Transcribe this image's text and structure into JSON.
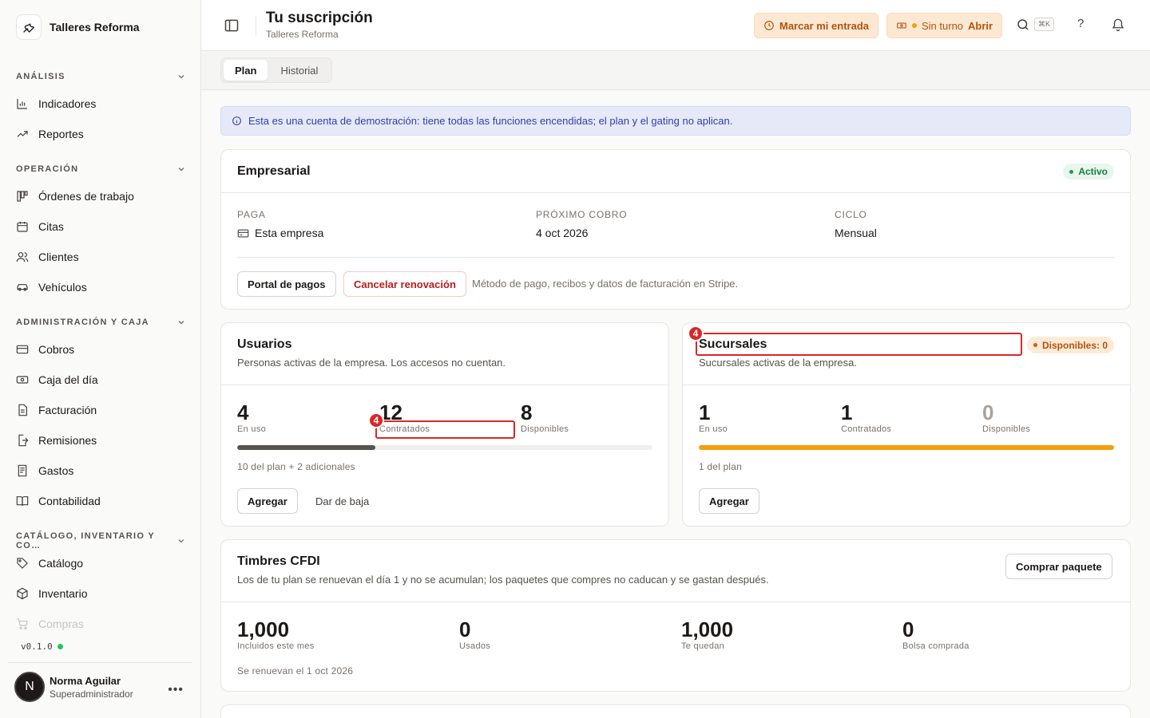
{
  "sidebar": {
    "brand": "Talleres Reforma",
    "sections": [
      {
        "title": "ANÁLISIS"
      },
      {
        "title": "OPERACIÓN"
      },
      {
        "title": "ADMINISTRACIÓN Y CAJA"
      },
      {
        "title": "CATÁLOGO, INVENTARIO Y CO…"
      }
    ],
    "items": [
      {
        "label": "Indicadores",
        "icon": "bar-chart-icon"
      },
      {
        "label": "Reportes",
        "icon": "trending-up-icon"
      },
      {
        "label": "Órdenes de trabajo",
        "icon": "kanban-icon"
      },
      {
        "label": "Citas",
        "icon": "calendar-icon"
      },
      {
        "label": "Clientes",
        "icon": "users-icon"
      },
      {
        "label": "Vehículos",
        "icon": "car-icon"
      },
      {
        "label": "Cobros",
        "icon": "credit-card-icon"
      },
      {
        "label": "Caja del día",
        "icon": "cash-icon"
      },
      {
        "label": "Facturación",
        "icon": "file-text-icon"
      },
      {
        "label": "Remisiones",
        "icon": "file-export-icon"
      },
      {
        "label": "Gastos",
        "icon": "receipt-icon"
      },
      {
        "label": "Contabilidad",
        "icon": "book-open-icon"
      },
      {
        "label": "Catálogo",
        "icon": "tags-icon"
      },
      {
        "label": "Inventario",
        "icon": "package-icon"
      },
      {
        "label": "Compras",
        "icon": "shopping-cart-icon"
      }
    ],
    "version": "v0.1.0",
    "user": {
      "initial": "N",
      "name": "Norma Aguilar",
      "role": "Superadministrador"
    }
  },
  "header": {
    "title": "Tu suscripción",
    "subtitle": "Talleres Reforma",
    "checkin_label": "Marcar mi entrada",
    "shift_status": "Sin turno",
    "shift_action": "Abrir",
    "shortcut": "⌘K",
    "help": "?"
  },
  "tabs": [
    {
      "label": "Plan"
    },
    {
      "label": "Historial"
    }
  ],
  "banner": "Esta es una cuenta de demostración: tiene todas las funciones encendidas; el plan y el gating no aplican.",
  "plan": {
    "name": "Empresarial",
    "status": "Activo",
    "pays_label": "PAGA",
    "pays_value": "Esta empresa",
    "next_label": "PRÓXIMO COBRO",
    "next_value": "4 oct 2026",
    "cycle_label": "CICLO",
    "cycle_value": "Mensual",
    "portal_button": "Portal de pagos",
    "cancel_button": "Cancelar renovación",
    "hint": "Método de pago, recibos y datos de facturación en Stripe."
  },
  "users": {
    "title": "Usuarios",
    "desc": "Personas activas de la empresa. Los accesos no cuentan.",
    "in_use": "4",
    "in_use_label": "En uso",
    "contracted": "12",
    "contracted_label": "Contratados",
    "available": "8",
    "available_label": "Disponibles",
    "usage_fraction": 0.333,
    "note": "10 del plan + 2 adicionales",
    "add_button": "Agregar",
    "remove_button": "Dar de baja",
    "marker": "4"
  },
  "branches": {
    "title": "Sucursales",
    "desc": "Sucursales activas de la empresa.",
    "badge": "Disponibles: 0",
    "in_use": "1",
    "in_use_label": "En uso",
    "contracted": "1",
    "contracted_label": "Contratados",
    "available": "0",
    "available_label": "Disponibles",
    "usage_fraction": 1.0,
    "note": "1 del plan",
    "add_button": "Agregar",
    "marker": "4"
  },
  "stamps": {
    "title": "Timbres CFDI",
    "desc": "Los de tu plan se renuevan el día 1 y no se acumulan; los paquetes que compres no caducan y se gastan después.",
    "buy_button": "Comprar paquete",
    "stats": [
      {
        "value": "1,000",
        "label": "Incluidos este mes"
      },
      {
        "value": "0",
        "label": "Usados"
      },
      {
        "value": "1,000",
        "label": "Te quedan"
      },
      {
        "value": "0",
        "label": "Bolsa comprada"
      }
    ],
    "note": "Se renuevan el 1 oct 2026"
  },
  "colors": {
    "accent_amber": "#f59e0b",
    "bar_dark": "#57534e",
    "danger": "#dc2626",
    "success": "#16a34a"
  }
}
